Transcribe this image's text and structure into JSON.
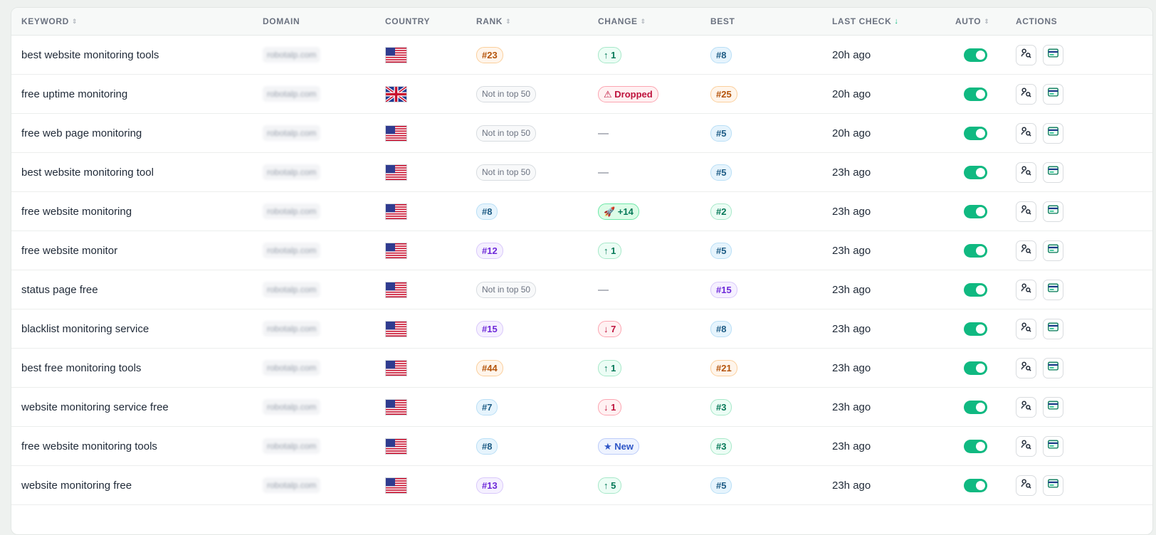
{
  "headers": {
    "keyword": "KEYWORD",
    "domain": "DOMAIN",
    "country": "COUNTRY",
    "rank": "RANK",
    "change": "CHANGE",
    "best": "BEST",
    "last_check": "LAST CHECK",
    "auto": "AUTO",
    "actions": "ACTIONS"
  },
  "colors": {
    "accent": "#10b981",
    "orange": "#b45309",
    "blue": "#1e5c85",
    "purple": "#6d28d9",
    "green": "#047857",
    "red": "#be123c"
  },
  "rows": [
    {
      "keyword": "best website monitoring tools",
      "domain": "robotalp.com",
      "country": "us",
      "rank": "#23",
      "rank_style": "orange",
      "change": "↑ 1",
      "change_style": "up",
      "best": "#8",
      "best_style": "blue",
      "last_check": "20h ago",
      "auto": true
    },
    {
      "keyword": "free uptime monitoring",
      "domain": "robotalp.com",
      "country": "uk",
      "rank": "Not in top 50",
      "rank_style": "gray",
      "change": "⚠ Dropped",
      "change_style": "red",
      "best": "#25",
      "best_style": "orange",
      "last_check": "20h ago",
      "auto": true
    },
    {
      "keyword": "free web page monitoring",
      "domain": "robotalp.com",
      "country": "us",
      "rank": "Not in top 50",
      "rank_style": "gray",
      "change": "—",
      "change_style": "dash",
      "best": "#5",
      "best_style": "blue",
      "last_check": "20h ago",
      "auto": true
    },
    {
      "keyword": "best website monitoring tool",
      "domain": "robotalp.com",
      "country": "us",
      "rank": "Not in top 50",
      "rank_style": "gray",
      "change": "—",
      "change_style": "dash",
      "best": "#5",
      "best_style": "blue",
      "last_check": "23h ago",
      "auto": true
    },
    {
      "keyword": "free website monitoring",
      "domain": "robotalp.com",
      "country": "us",
      "rank": "#8",
      "rank_style": "blue",
      "change": "🚀 +14",
      "change_style": "rocket",
      "best": "#2",
      "best_style": "green",
      "last_check": "23h ago",
      "auto": true
    },
    {
      "keyword": "free website monitor",
      "domain": "robotalp.com",
      "country": "us",
      "rank": "#12",
      "rank_style": "purple",
      "change": "↑ 1",
      "change_style": "up",
      "best": "#5",
      "best_style": "blue",
      "last_check": "23h ago",
      "auto": true
    },
    {
      "keyword": "status page free",
      "domain": "robotalp.com",
      "country": "us",
      "rank": "Not in top 50",
      "rank_style": "gray",
      "change": "—",
      "change_style": "dash",
      "best": "#15",
      "best_style": "purple",
      "last_check": "23h ago",
      "auto": true
    },
    {
      "keyword": "blacklist monitoring service",
      "domain": "robotalp.com",
      "country": "us",
      "rank": "#15",
      "rank_style": "purple",
      "change": "↓ 7",
      "change_style": "down",
      "best": "#8",
      "best_style": "blue",
      "last_check": "23h ago",
      "auto": true
    },
    {
      "keyword": "best free monitoring tools",
      "domain": "robotalp.com",
      "country": "us",
      "rank": "#44",
      "rank_style": "orange",
      "change": "↑ 1",
      "change_style": "up",
      "best": "#21",
      "best_style": "orange",
      "last_check": "23h ago",
      "auto": true
    },
    {
      "keyword": "website monitoring service free",
      "domain": "robotalp.com",
      "country": "us",
      "rank": "#7",
      "rank_style": "blue",
      "change": "↓ 1",
      "change_style": "down",
      "best": "#3",
      "best_style": "green",
      "last_check": "23h ago",
      "auto": true
    },
    {
      "keyword": "free website monitoring tools",
      "domain": "robotalp.com",
      "country": "us",
      "rank": "#8",
      "rank_style": "blue",
      "change": "★ New",
      "change_style": "navy",
      "best": "#3",
      "best_style": "green",
      "last_check": "23h ago",
      "auto": true
    },
    {
      "keyword": "website monitoring free",
      "domain": "robotalp.com",
      "country": "us",
      "rank": "#13",
      "rank_style": "purple",
      "change": "↑ 5",
      "change_style": "up",
      "best": "#5",
      "best_style": "blue",
      "last_check": "23h ago",
      "auto": true
    }
  ]
}
